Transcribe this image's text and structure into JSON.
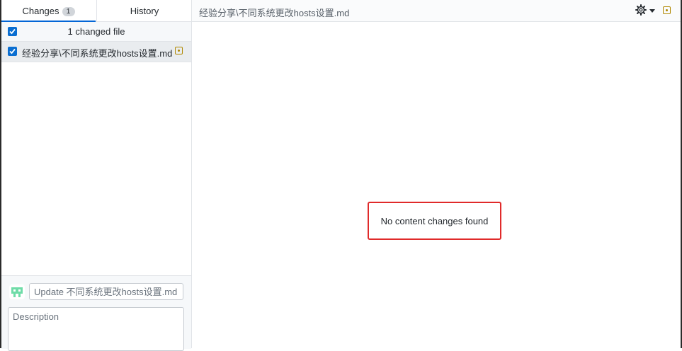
{
  "tabs": {
    "changes_label": "Changes",
    "changes_count": "1",
    "history_label": "History"
  },
  "changes": {
    "header_label": "1 changed file",
    "files": [
      {
        "name": "经验分享\\不同系统更改hosts设置.md",
        "status": "modified",
        "checked": true
      }
    ]
  },
  "commit": {
    "summary_placeholder": "Update 不同系统更改hosts设置.md",
    "description_placeholder": "Description"
  },
  "diff": {
    "file_path": "经验分享\\不同系统更改hosts设置.md",
    "empty_message": "No content changes found"
  },
  "icons": {
    "settings": "gear-icon",
    "dropdown": "caret-down-icon",
    "modified": "file-modified-icon",
    "avatar": "user-avatar"
  },
  "colors": {
    "accent": "#0366d6",
    "modified": "#b08800",
    "highlight_box": "#e02a2a",
    "avatar": "#6fdca8"
  }
}
